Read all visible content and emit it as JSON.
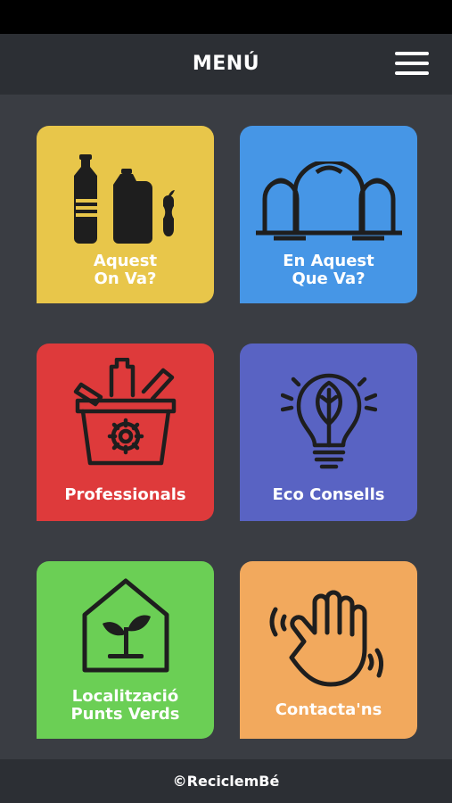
{
  "header": {
    "title": "MENÚ",
    "menu_icon": "hamburger-icon"
  },
  "tiles": [
    {
      "label": "Aquest\nOn Va?",
      "icon": "bottles-apple-icon",
      "color": "#e8c64a"
    },
    {
      "label": "En Aquest\nQue Va?",
      "icon": "recycling-containers-icon",
      "color": "#4696e6"
    },
    {
      "label": "Professionals",
      "icon": "recycling-bin-icon",
      "color": "#de3a3b"
    },
    {
      "label": "Eco Consells",
      "icon": "eco-lightbulb-icon",
      "color": "#5963c3"
    },
    {
      "label": "Localització\nPunts Verds",
      "icon": "house-plant-icon",
      "color": "#6bcf55"
    },
    {
      "label": "Contacta'ns",
      "icon": "waving-hand-icon",
      "color": "#f2a95d"
    }
  ],
  "footer": {
    "text": "©ReciclemBé"
  }
}
